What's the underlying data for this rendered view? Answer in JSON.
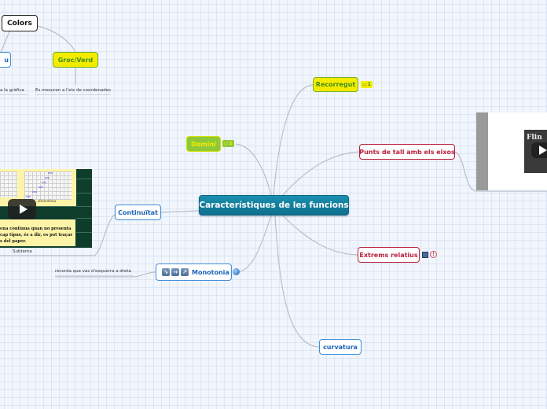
{
  "map": {
    "root": "Característiques de les funcions",
    "branches": {
      "recorregut": {
        "label": "Recorregut",
        "note_count": "1"
      },
      "domini": {
        "label": "Domini",
        "note_count": "1"
      },
      "punts_tall": {
        "label": "Punts de tall amb els eixos"
      },
      "continuitat": {
        "label": "Continuïtat"
      },
      "monotonia": {
        "label": "Monotonia"
      },
      "extrems": {
        "label": "Extrems relatius"
      },
      "curvatura": {
        "label": "curvatura"
      }
    },
    "colors": {
      "label": "Colors",
      "blau_partial": "u",
      "groc_verd": "Groc/Verd",
      "leaf_left": "a la gràfica",
      "leaf_right": "Es mesuren a l'eix de coordenades"
    },
    "continuitat_media": {
      "text_lines": [
        "ena contínua quan no presenta",
        "cap tipus, és a dir, es pot traçar",
        "s del paper."
      ],
      "caption": "Subtema"
    },
    "monotonia_leaf": "recorda que vas d'esquerra a dreta",
    "right_video_title": "Flin"
  },
  "colors": {
    "root": "#127e9e",
    "blue": "#3f8fd8",
    "yellow": "#f4ec00",
    "green": "#8fc93a",
    "red": "#b8203c"
  },
  "icons": {
    "note": "note-icon",
    "globe": "globe-icon",
    "play": "play-icon",
    "arrows": [
      "arrow-down-right-icon",
      "arrow-right-icon",
      "arrow-up-right-icon"
    ],
    "extrems": [
      "image-icon",
      "alert-icon"
    ]
  }
}
